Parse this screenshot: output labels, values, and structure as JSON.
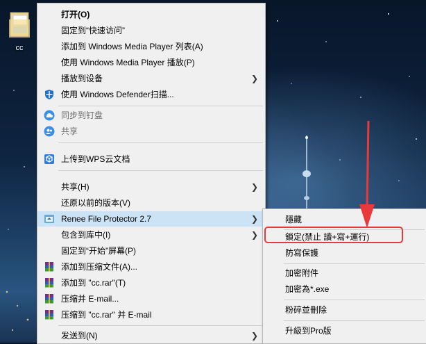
{
  "desktop": {
    "icon_label": "cc"
  },
  "context_menu": {
    "items": [
      {
        "label": "打开(O)",
        "bold": true
      },
      {
        "label": "固定到“快速访问”"
      },
      {
        "label": "添加到 Windows Media Player 列表(A)"
      },
      {
        "label": "使用 Windows Media Player 播放(P)"
      },
      {
        "label": "播放到设备",
        "submenu": true
      },
      {
        "label": "使用 Windows Defender扫描...",
        "icon": "windows-defender-icon"
      },
      {
        "label": "同步到钉盘",
        "icon": "dingpan-sync-icon",
        "disabled": true
      },
      {
        "label": "共享",
        "icon": "share-people-icon",
        "disabled": true
      },
      {
        "label": "上传到WPS云文档",
        "icon": "wps-cloud-icon"
      },
      {
        "label": "共享(H)",
        "submenu": true
      },
      {
        "label": "还原以前的版本(V)"
      },
      {
        "label": "Renee File Protector 2.7",
        "icon": "renee-file-protector-icon",
        "submenu": true
      },
      {
        "label": "包含到库中(I)",
        "submenu": true
      },
      {
        "label": "固定到“开始”屏幕(P)"
      },
      {
        "label": "添加到压缩文件(A)...",
        "icon": "winrar-icon"
      },
      {
        "label": "添加到 \"cc.rar\"(T)",
        "icon": "winrar-icon"
      },
      {
        "label": "压缩并 E-mail...",
        "icon": "winrar-icon"
      },
      {
        "label": "压缩到 \"cc.rar\" 并 E-mail",
        "icon": "winrar-icon"
      },
      {
        "label": "发送到(N)",
        "submenu": true
      }
    ]
  },
  "submenu": {
    "items": [
      {
        "label": "隱藏"
      },
      {
        "label": "鎖定(禁止 讀+寫+運行)"
      },
      {
        "label": "防寫保護"
      },
      {
        "label": "加密附件"
      },
      {
        "label": "加密為*.exe"
      },
      {
        "label": "粉碎並刪除"
      },
      {
        "label": "升級到Pro版"
      }
    ]
  },
  "annotation": {
    "color": "#e83a3a"
  }
}
